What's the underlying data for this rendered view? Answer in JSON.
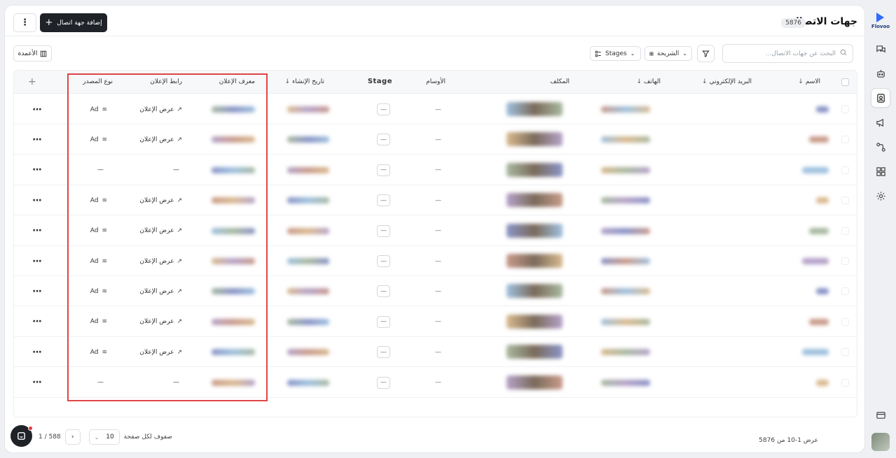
{
  "brand": {
    "name": "Flovoo",
    "accent": "#2f6bff"
  },
  "header": {
    "title": "جهات الاتصال",
    "count": "5876",
    "add_label": "إضافة جهة اتصال",
    "more_label": "⋮"
  },
  "toolbar": {
    "search_placeholder": "البحث عن جهات الاتصال...",
    "view_label": "الشريحة",
    "stages_label": "Stages",
    "columns_label": "الأعمدة"
  },
  "table": {
    "columns": {
      "name": "الاسم",
      "email": "البريد الإلكتروني",
      "phone": "الهاتف",
      "assignee": "المكلف",
      "tags": "الأوسام",
      "stage": "Stage",
      "created": "تاريخ الإنشاء",
      "ad_id": "معرف الإعلان",
      "ad_link": "رابط الإعلان",
      "source_type": "نوع المصدر"
    },
    "rows": [
      {
        "stage": "—",
        "tags": "—",
        "ad_link": "عرض الإعلان",
        "source": "Ad"
      },
      {
        "stage": "—",
        "tags": "—",
        "ad_link": "عرض الإعلان",
        "source": "Ad"
      },
      {
        "stage": "—",
        "tags": "—",
        "ad_link": "—",
        "source": "—"
      },
      {
        "stage": "—",
        "tags": "—",
        "ad_link": "عرض الإعلان",
        "source": "Ad"
      },
      {
        "stage": "—",
        "tags": "—",
        "ad_link": "عرض الإعلان",
        "source": "Ad"
      },
      {
        "stage": "—",
        "tags": "—",
        "ad_link": "عرض الإعلان",
        "source": "Ad"
      },
      {
        "stage": "—",
        "tags": "—",
        "ad_link": "عرض الإعلان",
        "source": "Ad"
      },
      {
        "stage": "—",
        "tags": "—",
        "ad_link": "عرض الإعلان",
        "source": "Ad"
      },
      {
        "stage": "—",
        "tags": "—",
        "ad_link": "عرض الإعلان",
        "source": "Ad"
      },
      {
        "stage": "—",
        "tags": "—",
        "ad_link": "—",
        "source": "—"
      }
    ]
  },
  "footer": {
    "summary": "عرض 1-10 من 5876",
    "rows_per_page_label": "صفوف لكل صفحة",
    "rows_per_page": "10",
    "page_indicator": "1 / 588"
  },
  "colors": {
    "highlight": "#e04545",
    "primary_button": "#1f2328"
  }
}
